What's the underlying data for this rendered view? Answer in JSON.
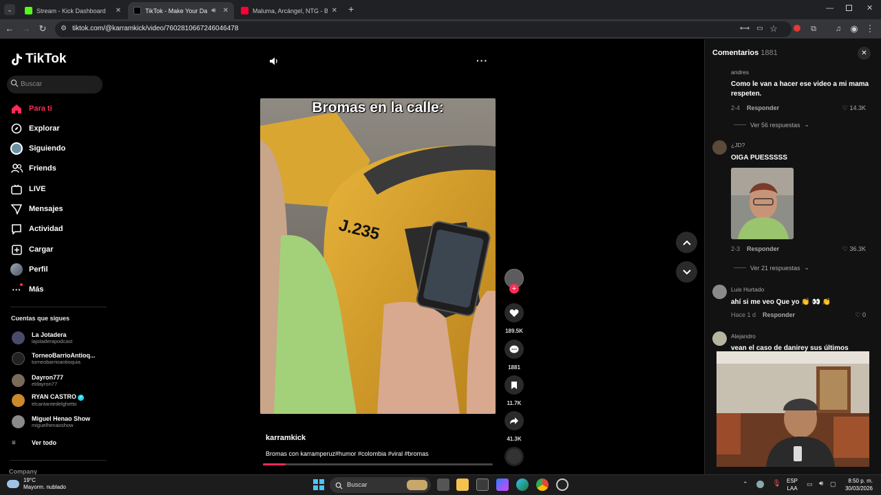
{
  "browser": {
    "tabs": [
      {
        "title": "Stream - Kick Dashboard",
        "color": "#53fc18"
      },
      {
        "title": "TikTok - Make Your Day",
        "color": "#000000"
      },
      {
        "title": "Maluma, Arcángel, NTG - BOTE",
        "color": "#ff0033"
      }
    ],
    "url": "tiktok.com/@karramkick/video/7602810667246046478"
  },
  "sidebar": {
    "brand": "TikTok",
    "search_placeholder": "Buscar",
    "nav": [
      {
        "label": "Para ti",
        "icon": "home-icon"
      },
      {
        "label": "Explorar",
        "icon": "compass-icon"
      },
      {
        "label": "Siguiendo",
        "icon": "following-icon"
      },
      {
        "label": "Friends",
        "icon": "friends-icon"
      },
      {
        "label": "LIVE",
        "icon": "live-icon"
      },
      {
        "label": "Mensajes",
        "icon": "messages-icon"
      },
      {
        "label": "Actividad",
        "icon": "activity-icon"
      },
      {
        "label": "Cargar",
        "icon": "upload-icon"
      },
      {
        "label": "Perfil",
        "icon": "profile-icon"
      },
      {
        "label": "Más",
        "icon": "more-icon"
      }
    ],
    "following_title": "Cuentas que sigues",
    "following": [
      {
        "name": "La Jotadera",
        "handle": "lajotaderapodcast"
      },
      {
        "name": "TorneoBarrioAntioq...",
        "handle": "torneobarrioantioquia"
      },
      {
        "name": "Dayron777",
        "handle": "eldayron77"
      },
      {
        "name": "RYAN CASTRO",
        "handle": "elcantantedelghetto"
      },
      {
        "name": "Miguel Henao Show",
        "handle": "miguelhenaoshow"
      }
    ],
    "see_all": "Ver todo",
    "company": "Company"
  },
  "video": {
    "caption_overlay": "Bromas en la calle:",
    "plate_text": "J.235",
    "author": "karramkick",
    "description": "Bromas con karramperuz#humor #colombia #viral #bromas",
    "progress": 0.1,
    "likes": "189.5K",
    "comments": "1881",
    "saves": "11.7K",
    "shares": "41.3K"
  },
  "comments": {
    "title": "Comentarios",
    "count": "1881",
    "items": [
      {
        "user": "andres",
        "text": "Como le van a hacer ese video a mi mama respeten.",
        "date": "2-4",
        "reply": "Responder",
        "likes": "14.3K",
        "more": "Ver 56 respuestas"
      },
      {
        "user": "¿JD?",
        "text": "OIGA PUESSSSS",
        "date": "2-3",
        "reply": "Responder",
        "likes": "36.3K",
        "more": "Ver 21 respuestas"
      },
      {
        "user": "Luis Hurtado",
        "text": "ahí si me veo Que yo 👏 👀 👏",
        "date": "Hace 1 d",
        "reply": "Responder",
        "likes": "0"
      },
      {
        "user": "Alejandro",
        "text": "vean el caso de danirey sus últimos"
      }
    ]
  },
  "taskbar": {
    "temp": "19°C",
    "weather": "Mayorm. nublado",
    "search_placeholder": "Buscar",
    "lang_top": "ESP",
    "lang_bottom": "LAA",
    "time": "8:50 p. m.",
    "date": "30/03/2026"
  }
}
